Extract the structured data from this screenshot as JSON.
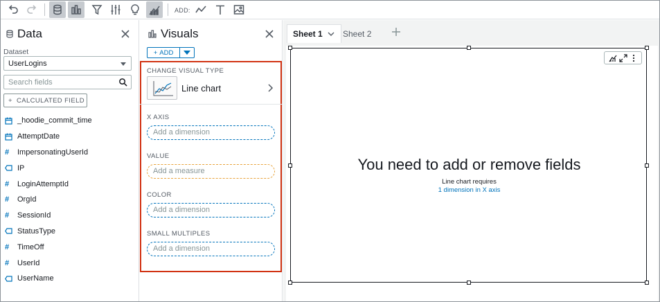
{
  "toolbar": {
    "add_label": "ADD:",
    "icons": [
      "undo-icon",
      "redo-icon",
      "dataset-icon",
      "visuals-icon",
      "filter-icon",
      "parameters-icon",
      "insights-icon",
      "themes-icon",
      "add-visual-icon",
      "add-text-icon",
      "add-image-icon"
    ]
  },
  "data_panel": {
    "title": "Data",
    "dataset_label": "Dataset",
    "dataset_value": "UserLogins",
    "search_placeholder": "Search fields",
    "calculated_field_button": "CALCULATED FIELD",
    "fields": [
      {
        "name": "_hoodie_commit_time",
        "type": "date"
      },
      {
        "name": "AttemptDate",
        "type": "date"
      },
      {
        "name": "ImpersonatingUserId",
        "type": "number"
      },
      {
        "name": "IP",
        "type": "string"
      },
      {
        "name": "LoginAttemptId",
        "type": "number"
      },
      {
        "name": "OrgId",
        "type": "number"
      },
      {
        "name": "SessionId",
        "type": "number"
      },
      {
        "name": "StatusType",
        "type": "string"
      },
      {
        "name": "TimeOff",
        "type": "number"
      },
      {
        "name": "UserId",
        "type": "number"
      },
      {
        "name": "UserName",
        "type": "string"
      }
    ]
  },
  "visuals_panel": {
    "title": "Visuals",
    "add_button": "ADD",
    "change_visual_type_label": "CHANGE VISUAL TYPE",
    "visual_type": "Line chart",
    "wells": [
      {
        "label": "X AXIS",
        "placeholder": "Add a dimension",
        "kind": "dimension"
      },
      {
        "label": "VALUE",
        "placeholder": "Add a measure",
        "kind": "measure"
      },
      {
        "label": "COLOR",
        "placeholder": "Add a dimension",
        "kind": "dimension"
      },
      {
        "label": "SMALL MULTIPLES",
        "placeholder": "Add a dimension",
        "kind": "dimension"
      }
    ]
  },
  "sheets": {
    "tabs": [
      "Sheet 1",
      "Sheet 2"
    ],
    "active": "Sheet 1"
  },
  "visual_message": {
    "title": "You need to add or remove fields",
    "subtitle": "Line chart requires",
    "link": "1 dimension in X axis"
  },
  "colors": {
    "accent": "#0073bb",
    "highlight_border": "#d13212",
    "measure_border": "#e8a33b"
  }
}
